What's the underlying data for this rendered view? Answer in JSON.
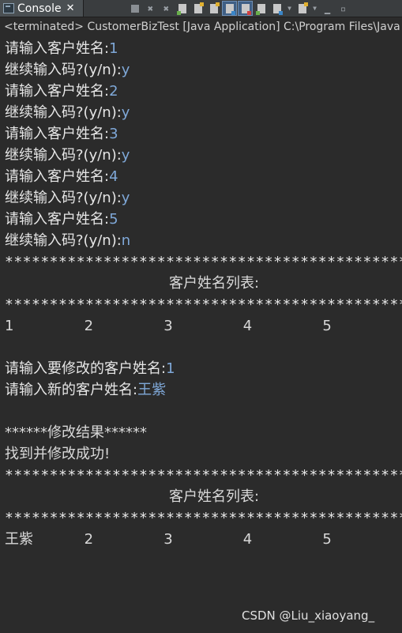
{
  "tab": {
    "title": "Console"
  },
  "launch_info": "<terminated> CustomerBizTest [Java Application] C:\\Program Files\\Java",
  "dialog1": [
    {
      "prompt": "请输入客户姓名:",
      "input": "1"
    },
    {
      "prompt": "继续输入码?(y/n):",
      "input": "y"
    },
    {
      "prompt": "请输入客户姓名:",
      "input": "2"
    },
    {
      "prompt": "继续输入码?(y/n):",
      "input": "y"
    },
    {
      "prompt": "请输入客户姓名:",
      "input": "3"
    },
    {
      "prompt": "继续输入码?(y/n):",
      "input": "y"
    },
    {
      "prompt": "请输入客户姓名:",
      "input": "4"
    },
    {
      "prompt": "继续输入码?(y/n):",
      "input": "y"
    },
    {
      "prompt": "请输入客户姓名:",
      "input": "5"
    },
    {
      "prompt": "继续输入码?(y/n):",
      "input": "n"
    }
  ],
  "separator": "***************************************************************",
  "list_title": "客户姓名列表:",
  "list1": [
    "1",
    "2",
    "3",
    "4",
    "5"
  ],
  "modify": {
    "prompt_old": "请输入要修改的客户姓名:",
    "input_old": "1",
    "prompt_new": "请输入新的客户姓名:",
    "input_new": "王紫"
  },
  "result_header": "******修改结果******",
  "result_message": "找到并修改成功!",
  "list2": [
    "王紫",
    "2",
    "3",
    "4",
    "5"
  ],
  "watermark": "CSDN @Liu_xiaoyang_"
}
